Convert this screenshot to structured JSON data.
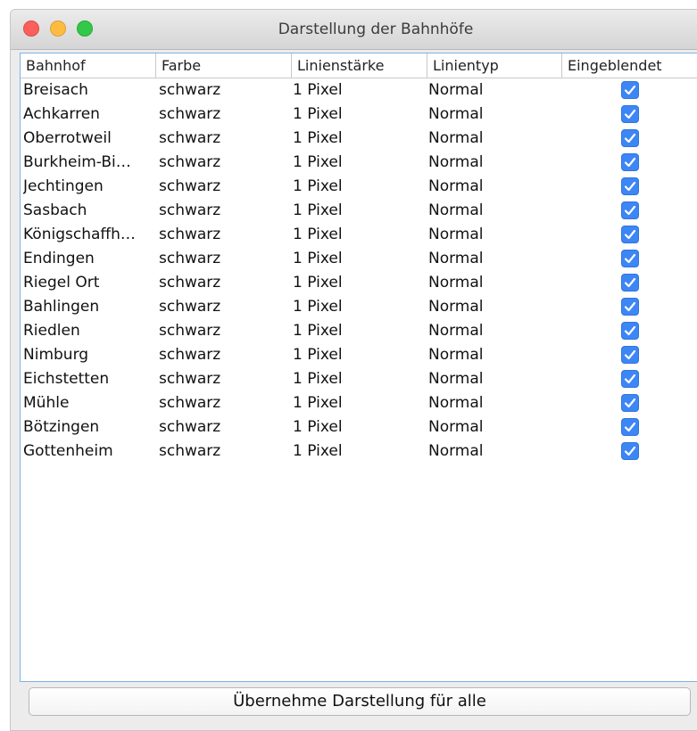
{
  "window": {
    "title": "Darstellung der Bahnhöfe"
  },
  "table": {
    "headers": [
      "Bahnhof",
      "Farbe",
      "Linienstärke",
      "Linientyp",
      "Eingeblendet"
    ],
    "rows": [
      {
        "bahnhof": "Breisach",
        "farbe": "schwarz",
        "staerke": "1 Pixel",
        "typ": "Normal",
        "eingeblendet": true
      },
      {
        "bahnhof": "Achkarren",
        "farbe": "schwarz",
        "staerke": "1 Pixel",
        "typ": "Normal",
        "eingeblendet": true
      },
      {
        "bahnhof": "Oberrotweil",
        "farbe": "schwarz",
        "staerke": "1 Pixel",
        "typ": "Normal",
        "eingeblendet": true
      },
      {
        "bahnhof": "Burkheim-Bi…",
        "farbe": "schwarz",
        "staerke": "1 Pixel",
        "typ": "Normal",
        "eingeblendet": true
      },
      {
        "bahnhof": "Jechtingen",
        "farbe": "schwarz",
        "staerke": "1 Pixel",
        "typ": "Normal",
        "eingeblendet": true
      },
      {
        "bahnhof": "Sasbach",
        "farbe": "schwarz",
        "staerke": "1 Pixel",
        "typ": "Normal",
        "eingeblendet": true
      },
      {
        "bahnhof": "Königschaffh…",
        "farbe": "schwarz",
        "staerke": "1 Pixel",
        "typ": "Normal",
        "eingeblendet": true
      },
      {
        "bahnhof": "Endingen",
        "farbe": "schwarz",
        "staerke": "1 Pixel",
        "typ": "Normal",
        "eingeblendet": true
      },
      {
        "bahnhof": "Riegel Ort",
        "farbe": "schwarz",
        "staerke": "1 Pixel",
        "typ": "Normal",
        "eingeblendet": true
      },
      {
        "bahnhof": "Bahlingen",
        "farbe": "schwarz",
        "staerke": "1 Pixel",
        "typ": "Normal",
        "eingeblendet": true
      },
      {
        "bahnhof": "Riedlen",
        "farbe": "schwarz",
        "staerke": "1 Pixel",
        "typ": "Normal",
        "eingeblendet": true
      },
      {
        "bahnhof": "Nimburg",
        "farbe": "schwarz",
        "staerke": "1 Pixel",
        "typ": "Normal",
        "eingeblendet": true
      },
      {
        "bahnhof": "Eichstetten",
        "farbe": "schwarz",
        "staerke": "1 Pixel",
        "typ": "Normal",
        "eingeblendet": true
      },
      {
        "bahnhof": "Mühle",
        "farbe": "schwarz",
        "staerke": "1 Pixel",
        "typ": "Normal",
        "eingeblendet": true
      },
      {
        "bahnhof": "Bötzingen",
        "farbe": "schwarz",
        "staerke": "1 Pixel",
        "typ": "Normal",
        "eingeblendet": true
      },
      {
        "bahnhof": "Gottenheim",
        "farbe": "schwarz",
        "staerke": "1 Pixel",
        "typ": "Normal",
        "eingeblendet": true
      }
    ]
  },
  "footer": {
    "apply_all_label": "Übernehme Darstellung für alle"
  },
  "colors": {
    "checkbox": "#3d86f5",
    "selection_border": "#7eb3e8"
  }
}
